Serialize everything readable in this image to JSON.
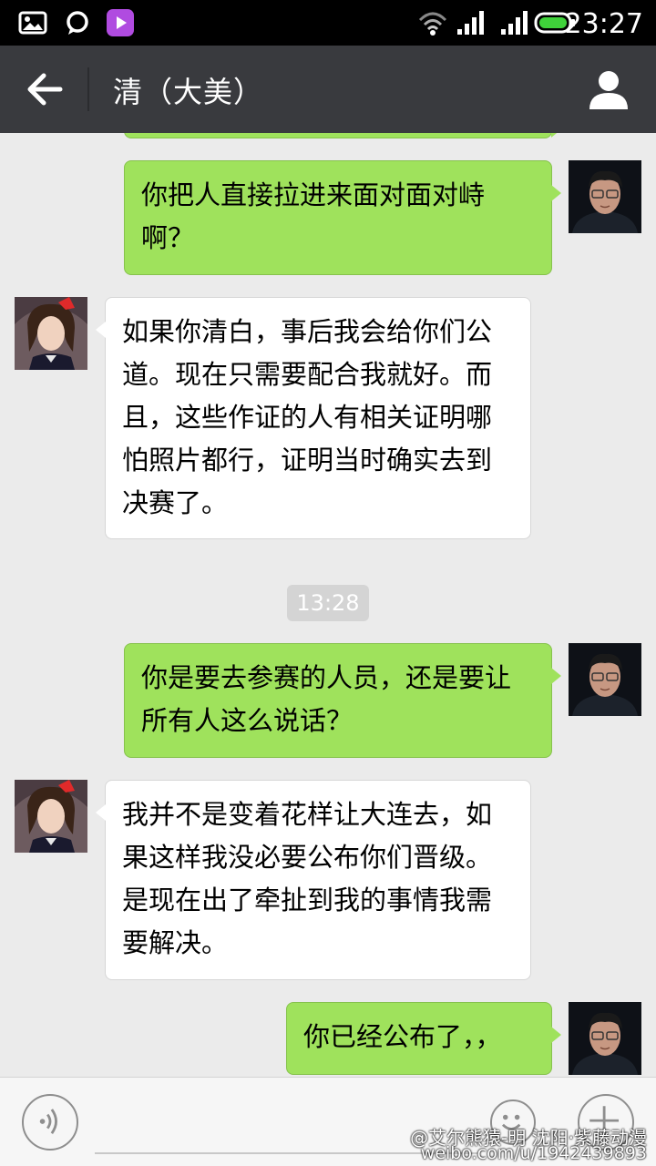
{
  "status_bar": {
    "time": "23:27",
    "icons": [
      "gallery-icon",
      "chat-notification-icon",
      "video-app-icon",
      "wifi-icon",
      "signal-icon",
      "signal-icon",
      "battery-icon"
    ]
  },
  "nav": {
    "title": "清（大美）",
    "back_icon": "arrow-left-icon",
    "contact_icon": "person-icon"
  },
  "messages": [
    {
      "direction": "out",
      "text": "你把人直接拉进来面对面对峙啊？"
    },
    {
      "direction": "in",
      "text": "如果你清白，事后我会给你们公道。现在只需要配合我就好。而且，这些作证的人有相关证明哪怕照片都行，证明当时确实去到决赛了。"
    },
    {
      "direction": "out",
      "text": "你是要去参赛的人员，还是要让所有人这么说话？"
    },
    {
      "direction": "in",
      "text": "我并不是变着花样让大连去，如果这样我没必要公布你们晋级。是现在出了牵扯到我的事情我需要解决。"
    },
    {
      "direction": "out",
      "text": "你已经公布了，，"
    }
  ],
  "timestamp": "13:28",
  "input_bar": {
    "voice_icon": "voice-icon",
    "emoji_icon": "emoji-icon",
    "plus_icon": "plus-icon"
  },
  "watermark": {
    "line1": "@艾尔熊猿-明 沈阳·紫藤动漫",
    "line2": "weibo.com/u/1942439893"
  }
}
